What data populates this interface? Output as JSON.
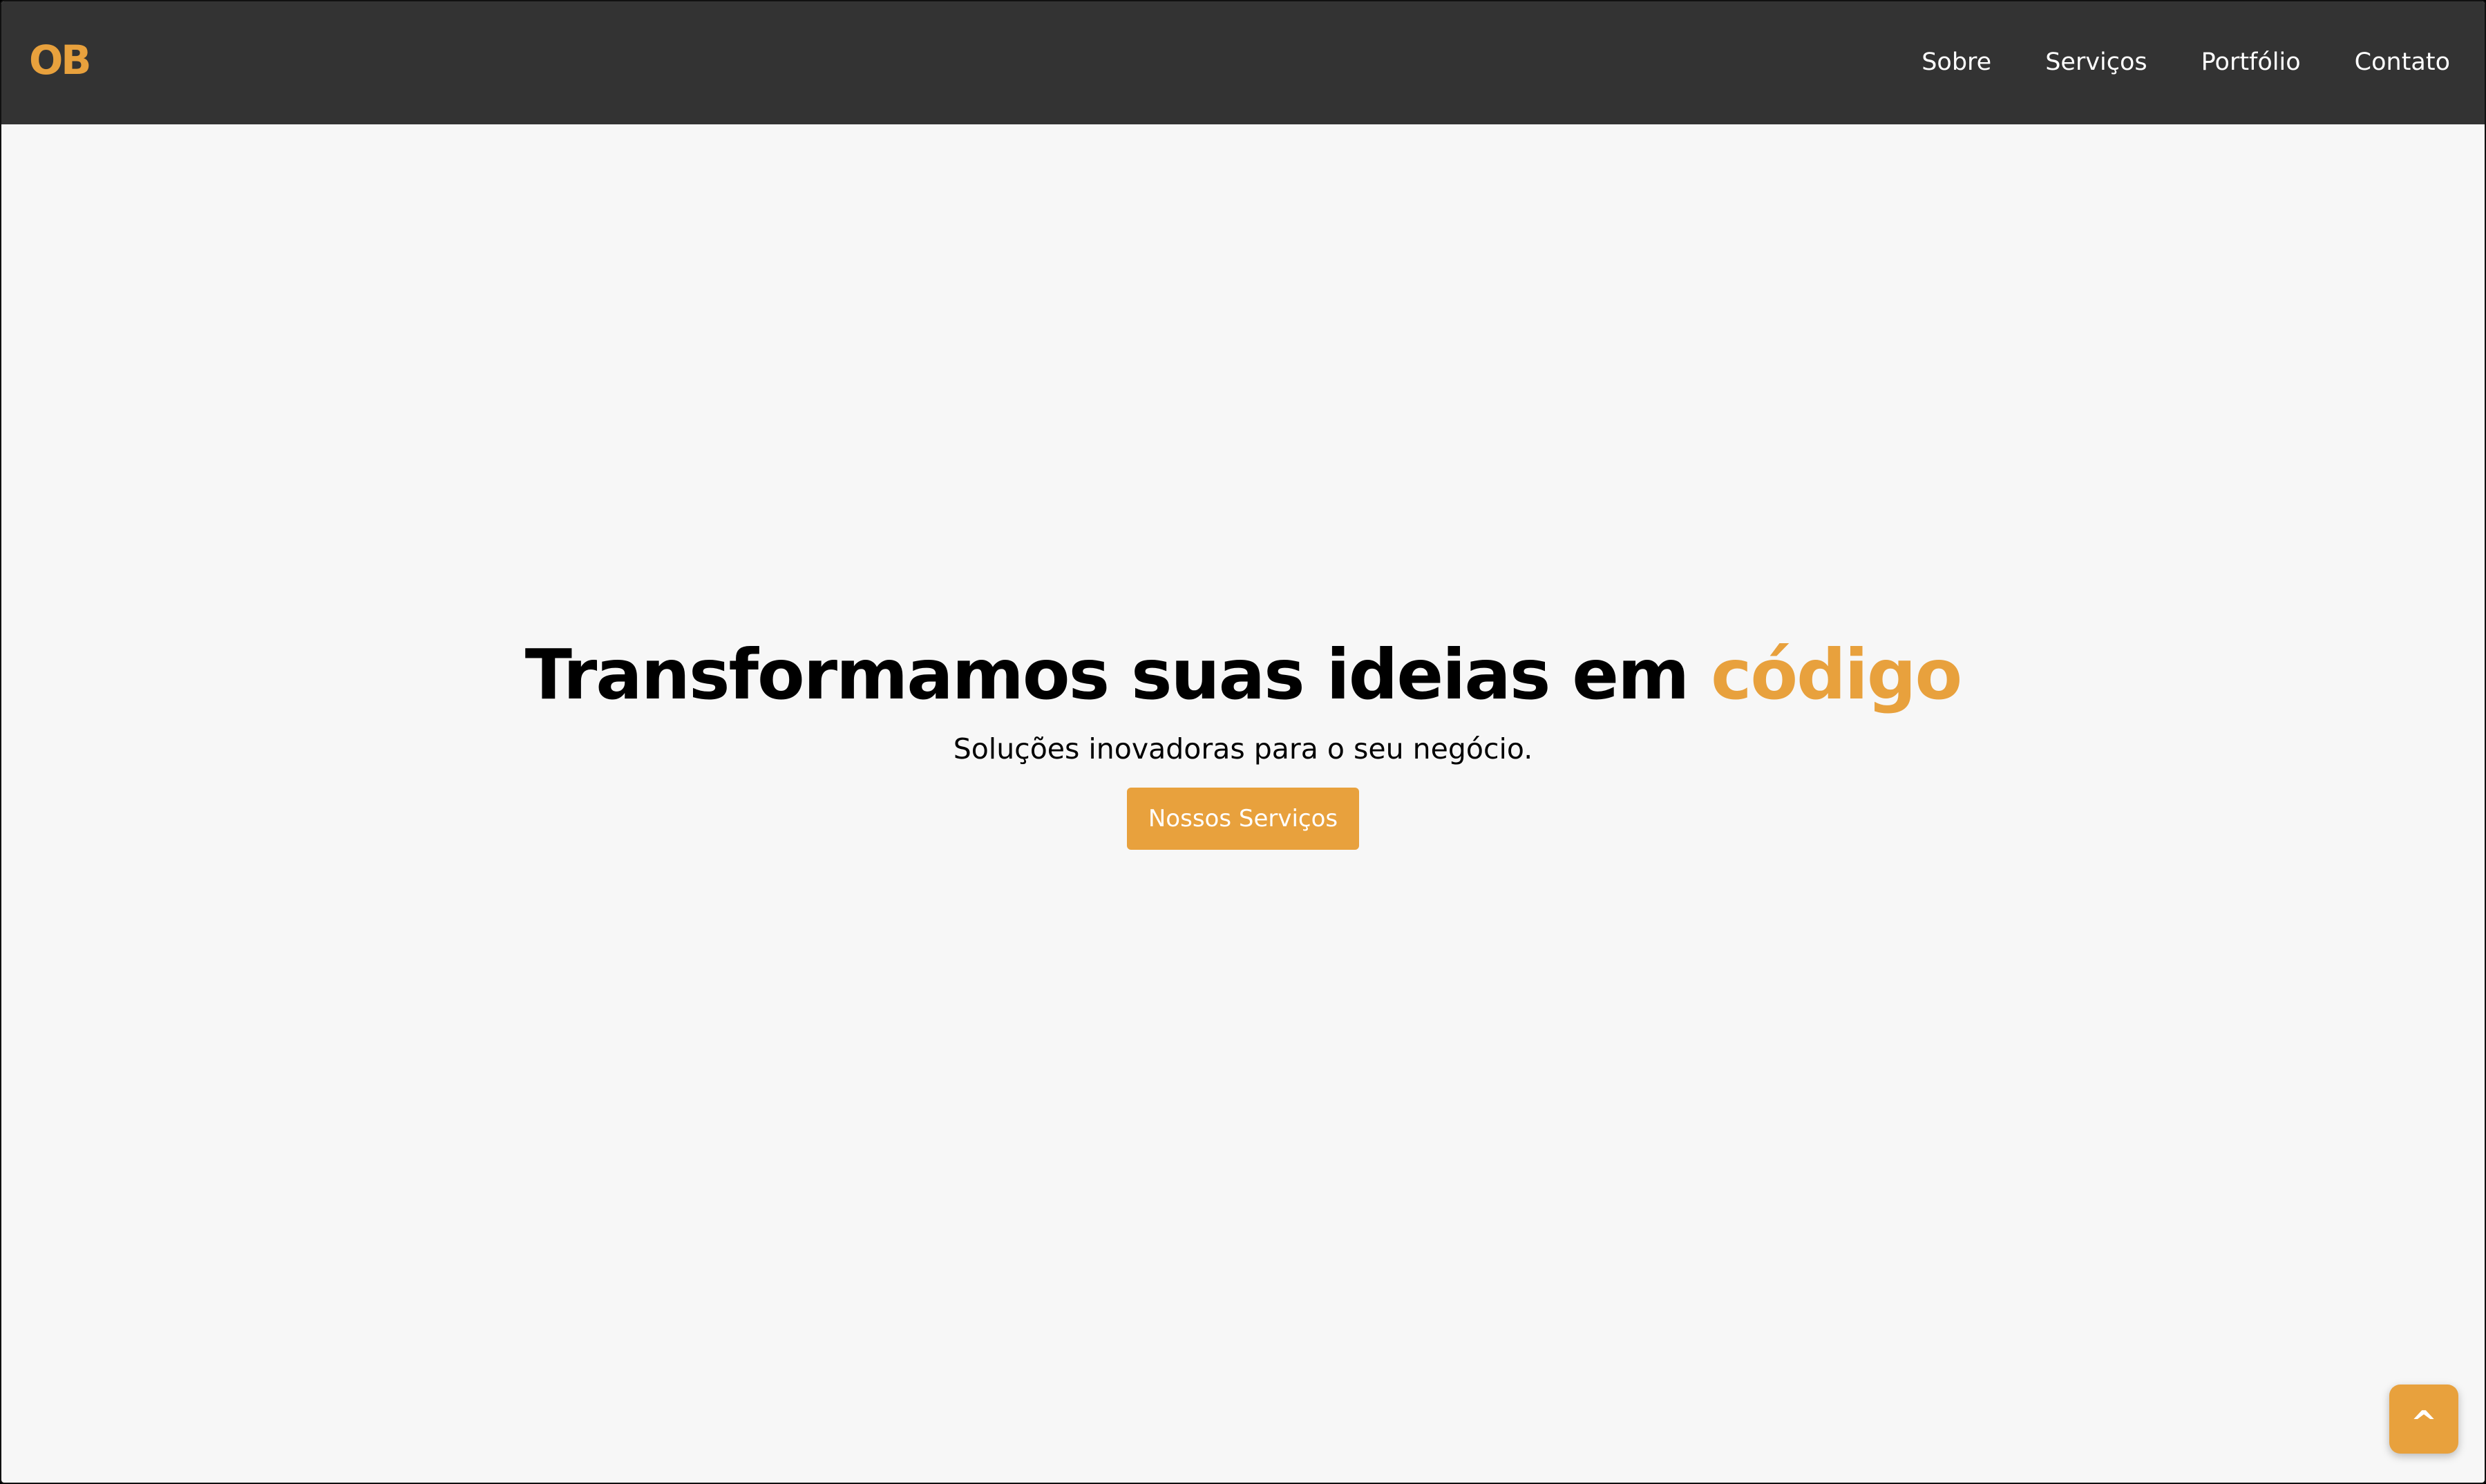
{
  "header": {
    "logo": "OB",
    "nav": [
      {
        "label": "Sobre"
      },
      {
        "label": "Serviços"
      },
      {
        "label": "Portfólio"
      },
      {
        "label": "Contato"
      }
    ]
  },
  "hero": {
    "title_main": "Transformamos suas ideias em ",
    "title_accent": "código",
    "subtitle": "Soluções inovadoras para o seu negócio.",
    "cta_label": "Nossos Serviços"
  },
  "back_to_top": {
    "label": "^"
  },
  "colors": {
    "accent": "#e8a13d",
    "navbar": "#333333",
    "background": "#f7f7f7"
  }
}
